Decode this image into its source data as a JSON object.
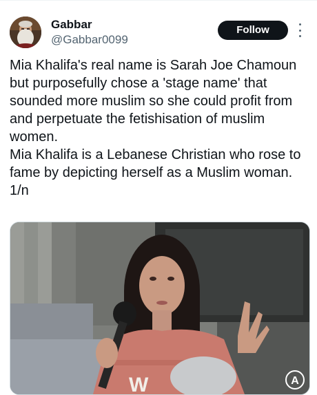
{
  "tweet": {
    "author": {
      "name": "Gabbar",
      "handle": "@Gabbar0099",
      "avatar_icon": "bearded-man-avatar"
    },
    "follow_label": "Follow",
    "more_icon": "vertical-ellipsis-icon",
    "text": "Mia Khalifa's real name is Sarah Joe Chamoun but purposefully chose a 'stage name' that sounded more muslim so she could profit from and perpetuate the fetishisation of muslim women.\nMia Khalifa is a Lebanese Christian who rose to fame by depicting herself as a Muslim woman. 1/n",
    "media": {
      "type": "photo",
      "watermark_icon": "barstool-logo"
    }
  },
  "colors": {
    "text": "#0f1419",
    "secondary": "#536471",
    "button_bg": "#0f1419",
    "button_text": "#ffffff",
    "border": "#cfd9de"
  }
}
